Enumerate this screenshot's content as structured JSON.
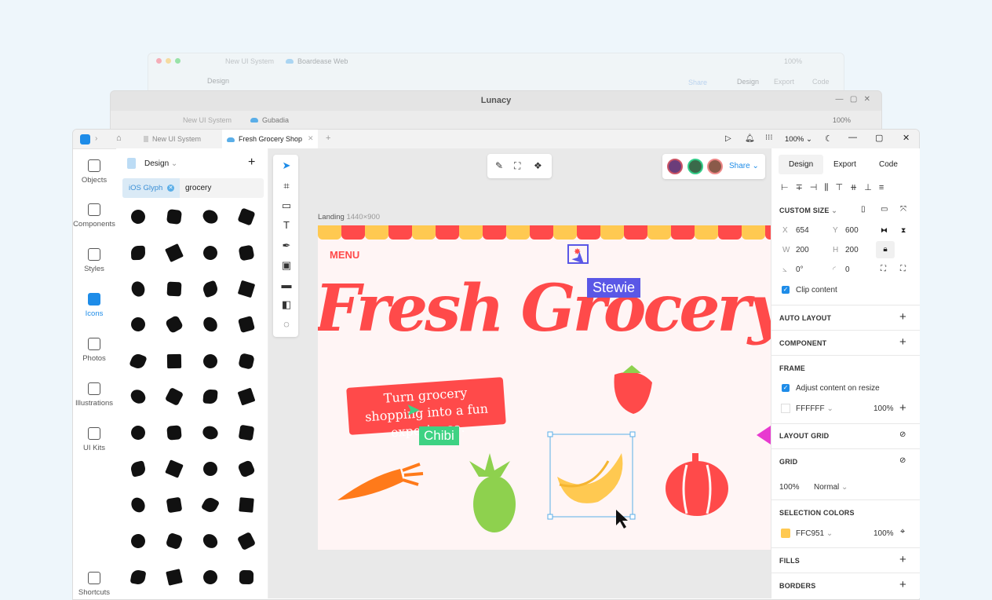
{
  "back_window_1": {
    "tabs": [
      "New UI System",
      "Boardease Web"
    ],
    "zoom": "100%",
    "panel_title": "Design",
    "share": "Share",
    "right_tabs": [
      "Design",
      "Export",
      "Code"
    ]
  },
  "back_window_2": {
    "title": "Lunacy",
    "tabs": [
      "New UI System",
      "Gubadia"
    ],
    "zoom": "100%"
  },
  "main": {
    "tabs": [
      {
        "label": "New UI System"
      },
      {
        "label": "Fresh Grocery Shop",
        "active": true
      }
    ],
    "zoom": "100%",
    "rail": [
      {
        "label": "Objects",
        "icon": "layers-icon"
      },
      {
        "label": "Components",
        "icon": "components-icon"
      },
      {
        "label": "Styles",
        "icon": "paint-roller-icon"
      },
      {
        "label": "Icons",
        "icon": "icons-icon",
        "active": true
      },
      {
        "label": "Photos",
        "icon": "camera-icon"
      },
      {
        "label": "Illustrations",
        "icon": "pen-nib-icon"
      },
      {
        "label": "UI Kits",
        "icon": "grid-icon"
      },
      {
        "label": "Shortcuts",
        "icon": "keyboard-icon"
      }
    ],
    "panel": {
      "title": "Design",
      "filter_chip": "iOS Glyph",
      "search_value": "grocery",
      "icons": [
        "eggplant",
        "pot",
        "wheat",
        "jar",
        "sign",
        "leaf",
        "chef-hat",
        "egg",
        "dumpling",
        "cooking-pot",
        "no-fruit",
        "fridge",
        "tomato",
        "fish-bone",
        "no-bottle",
        "cookie",
        "tin-can",
        "calendar",
        "blender",
        "mango",
        "wheat-ear",
        "kebab",
        "strawberry",
        "beans",
        "calculator",
        "books",
        "coconut",
        "cucumber",
        "watermelon",
        "burger",
        "star-anise",
        "chili",
        "pizza",
        "cake",
        "battery",
        "bug",
        "lemon",
        "yoga",
        "noodles",
        "hotpot",
        "receipt",
        "scarecrow",
        "hook",
        "apple"
      ]
    },
    "frame": {
      "name": "Landing",
      "size": "1440×900",
      "menu": "MENU",
      "headline": "Fresh Grocery Shop",
      "tagline": "Turn grocery shopping into a fun experience.",
      "cursors": [
        {
          "name": "Stewie",
          "color": "#5a57e6"
        },
        {
          "name": "Chibi",
          "color": "#3ed283"
        }
      ],
      "colors": {
        "red": "#ff4a4a",
        "yellow": "#ffc951",
        "green": "#8ed14e",
        "orange": "#ff7a1a"
      }
    },
    "share": "Share",
    "right": {
      "tabs": [
        "Design",
        "Export",
        "Code"
      ],
      "size_preset": "CUSTOM SIZE",
      "x": "654",
      "y": "600",
      "w": "200",
      "h": "200",
      "rotation": "0°",
      "radius": "0",
      "clip_content": "Clip content",
      "sections": {
        "auto_layout": "AUTO LAYOUT",
        "component": "COMPONENT",
        "frame": "FRAME",
        "layout_grid": "LAYOUT GRID",
        "grid": "GRID",
        "selection_colors": "SELECTION COLORS",
        "fills": "FILLS",
        "borders": "BORDERS"
      },
      "adjust": "Adjust content on resize",
      "frame_fill": "FFFFFF",
      "frame_opacity": "100%",
      "grid_opacity": "100%",
      "blend": "Normal",
      "sel_color": "FFC951",
      "sel_opacity": "100%",
      "labels": {
        "x": "X",
        "y": "Y",
        "w": "W",
        "h": "H"
      }
    }
  }
}
